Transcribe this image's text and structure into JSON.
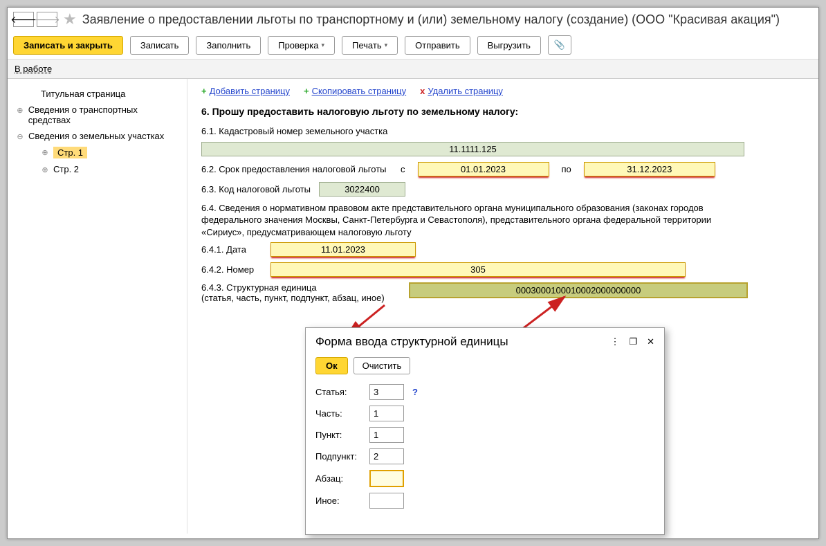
{
  "title": "Заявление о предоставлении льготы по транспортному и (или) земельному налогу (создание) (ООО \"Красивая акация\")",
  "toolbar": {
    "save_close": "Записать и закрыть",
    "save": "Записать",
    "fill": "Заполнить",
    "check": "Проверка",
    "print": "Печать",
    "send": "Отправить",
    "export": "Выгрузить"
  },
  "status": {
    "label": "В работе"
  },
  "sidebar": {
    "items": [
      {
        "label": "Титульная страница",
        "icon": ""
      },
      {
        "label": "Сведения о транспортных средствах",
        "icon": "plus"
      },
      {
        "label": "Сведения о земельных участках",
        "icon": "minus"
      },
      {
        "label": "Стр. 1",
        "icon": "plus",
        "level": 2,
        "active": true
      },
      {
        "label": "Стр. 2",
        "icon": "plus",
        "level": 2
      }
    ]
  },
  "page_actions": {
    "add": "Добавить страницу",
    "copy": "Скопировать страницу",
    "delete": "Удалить страницу"
  },
  "form": {
    "section_title": "6. Прошу предоставить налоговую льготу по земельному налогу:",
    "f61_label": "6.1. Кадастровый номер земельного участка",
    "f61_value": "11.1111.125",
    "f62_label": "6.2. Срок предоставления налоговой льготы",
    "f62_from_label": "с",
    "f62_from": "01.01.2023",
    "f62_to_label": "по",
    "f62_to": "31.12.2023",
    "f63_label": "6.3. Код налоговой льготы",
    "f63_value": "3022400",
    "f64_label": "6.4. Сведения о нормативном правовом акте представительного органа муниципального образования (законах городов федерального значения Москвы, Санкт-Петербурга и Севастополя), представительного органа федеральной территории «Сириус», предусматривающем налоговую льготу",
    "f641_label": "6.4.1. Дата",
    "f641_value": "11.01.2023",
    "f642_label": "6.4.2. Номер",
    "f642_value": "305",
    "f643_label": "6.4.3. Структурная единица",
    "f643_subtext": "(статья, часть, пункт, подпункт, абзац, иное)",
    "f643_value": "0003000100010002000000000"
  },
  "dialog": {
    "title": "Форма ввода структурной единицы",
    "ok": "Ок",
    "clear": "Очистить",
    "fields": {
      "article_label": "Статья:",
      "article_value": "3",
      "part_label": "Часть:",
      "part_value": "1",
      "point_label": "Пункт:",
      "point_value": "1",
      "subpoint_label": "Подпункт:",
      "subpoint_value": "2",
      "paragraph_label": "Абзац:",
      "paragraph_value": "",
      "other_label": "Иное:",
      "other_value": ""
    }
  }
}
